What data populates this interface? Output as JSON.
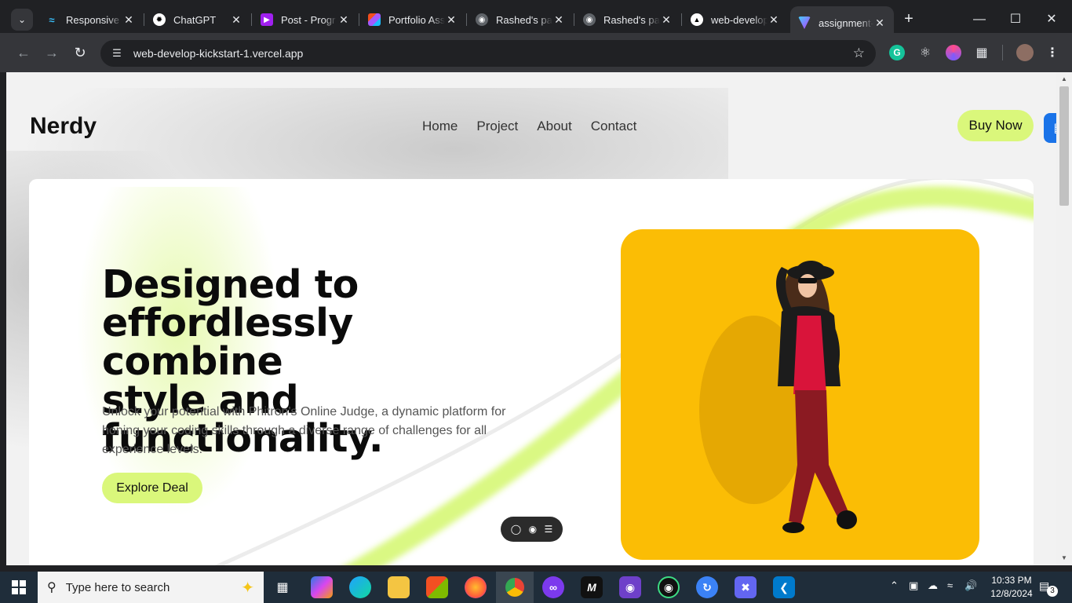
{
  "browser": {
    "tabs": [
      {
        "title": "Responsive",
        "icon": "tailwind-icon",
        "color": "#38bdf8"
      },
      {
        "title": "ChatGPT",
        "icon": "chatgpt-icon",
        "color": "#ffffff"
      },
      {
        "title": "Post - Progr",
        "icon": "programming-hero-icon",
        "color": "#a020f0"
      },
      {
        "title": "Portfolio Ass",
        "icon": "figma-icon",
        "color": "#f24e1e"
      },
      {
        "title": "Rashed's pag",
        "icon": "globe-icon",
        "color": "#9aa0a6"
      },
      {
        "title": "Rashed's pag",
        "icon": "globe-icon",
        "color": "#9aa0a6"
      },
      {
        "title": "web-develop",
        "icon": "vercel-icon",
        "color": "#ffffff"
      },
      {
        "title": "assignment-",
        "icon": "vite-icon",
        "color": "#bd34fe"
      }
    ],
    "url": "web-develop-kickstart-1.vercel.app"
  },
  "page": {
    "logo": "Nerdy",
    "nav": [
      "Home",
      "Project",
      "About",
      "Contact"
    ],
    "buy_label": "Buy Now",
    "headline_line1": "Designed to",
    "headline_line2": "effordlessly combine",
    "headline_line3": "style and functionality.",
    "subtext": "Unlock your potential with Phitron's Online Judge, a dynamic platform for honing your coding skills through a diverse range of challenges for all experience levels.",
    "cta_label": "Explore Deal",
    "accent_color": "#daf77b",
    "photo_bg": "#fbbd05"
  },
  "taskbar": {
    "search_placeholder": "Type here to search",
    "time": "10:33 PM",
    "date": "12/8/2024",
    "notification_count": "3"
  }
}
